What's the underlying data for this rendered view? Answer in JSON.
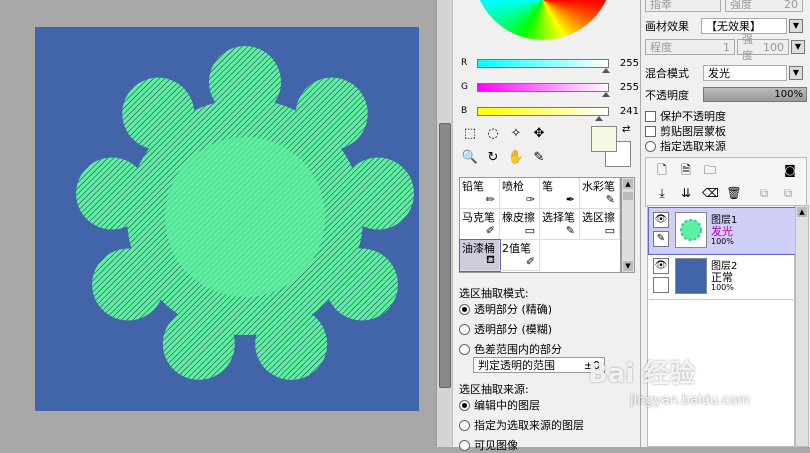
{
  "color_panel": {
    "sliders": [
      {
        "label": "R",
        "value": "255",
        "level": 1.0,
        "gradient": "linear-gradient(90deg,#00ffff,#ffffff)"
      },
      {
        "label": "G",
        "value": "255",
        "level": 1.0,
        "gradient": "linear-gradient(90deg,#ff00ff,#ffffff)"
      },
      {
        "label": "B",
        "value": "241",
        "level": 0.945,
        "gradient": "linear-gradient(90deg,#ffff00,#ffffff)"
      }
    ],
    "foreground_color": "#f5f8e4",
    "background_color": "#ffffff"
  },
  "tools": [
    {
      "icon": "rect-select-icon",
      "glyph": "⬚"
    },
    {
      "icon": "lasso-icon",
      "glyph": "◌"
    },
    {
      "icon": "magic-wand-icon",
      "glyph": "✧"
    },
    {
      "icon": "move-icon",
      "glyph": "✥"
    },
    {
      "icon": "zoom-icon",
      "glyph": "🔍"
    },
    {
      "icon": "rotate-icon",
      "glyph": "↻"
    },
    {
      "icon": "hand-icon",
      "glyph": "✋"
    },
    {
      "icon": "eyedropper-icon",
      "glyph": "✎"
    }
  ],
  "brushes": [
    {
      "label": "铅笔",
      "icon": "pencil-icon",
      "glyph": "✏"
    },
    {
      "label": "喷枪",
      "icon": "airbrush-icon",
      "glyph": "✑"
    },
    {
      "label": "笔",
      "icon": "pen-icon",
      "glyph": "✒"
    },
    {
      "label": "水彩笔",
      "icon": "watercolor-icon",
      "glyph": "✎"
    },
    {
      "label": "马克笔",
      "icon": "marker-icon",
      "glyph": "✐"
    },
    {
      "label": "橡皮擦",
      "icon": "eraser-icon",
      "glyph": "▭"
    },
    {
      "label": "选择笔",
      "icon": "select-pen-icon",
      "glyph": "✎"
    },
    {
      "label": "选区擦",
      "icon": "select-eraser-icon",
      "glyph": "▭"
    },
    {
      "label": "油漆桶",
      "icon": "bucket-icon",
      "glyph": "⛾"
    },
    {
      "label": "2值笔",
      "icon": "binary-pen-icon",
      "glyph": "✐"
    }
  ],
  "selection": {
    "mode_title": "选区抽取模式:",
    "modes": [
      "透明部分 (精确)",
      "透明部分 (模糊)",
      "色差范围内的部分"
    ],
    "range_label": "判定透明的范围",
    "range_value": "±0",
    "source_title": "选区抽取来源:",
    "sources": [
      "编辑中的图层",
      "指定为选取来源的图层",
      "可见图像"
    ]
  },
  "right_panel": {
    "top_field1": "指幸",
    "top_field2": "强度",
    "top_field2_value": "20",
    "texture_label": "画材效果",
    "texture_value": "【无效果】",
    "degree_label": "程度",
    "degree_value": "1",
    "strength_label": "强度",
    "strength_value": "100",
    "blend_label": "混合模式",
    "blend_value": "发光",
    "opacity_label": "不透明度",
    "opacity_value": "100%",
    "opacity_level": 1.0,
    "checkboxes": [
      "保护不透明度",
      "剪贴图层蒙板",
      "指定选取来源"
    ]
  },
  "layers": [
    {
      "name": "图层1",
      "mode": "发光",
      "opacity": "100%",
      "mode_color": "#b000b0",
      "thumb": "#ffffff"
    },
    {
      "name": "图层2",
      "mode": "正常",
      "opacity": "100%",
      "mode_color": "#000000",
      "thumb": "#4264a8"
    }
  ],
  "watermark": {
    "logo": "Bai 经验",
    "url": "jingyan.baidu.com"
  },
  "colors": {
    "canvas_bg": "#4264a8",
    "pattern": "#5ef0a0"
  }
}
